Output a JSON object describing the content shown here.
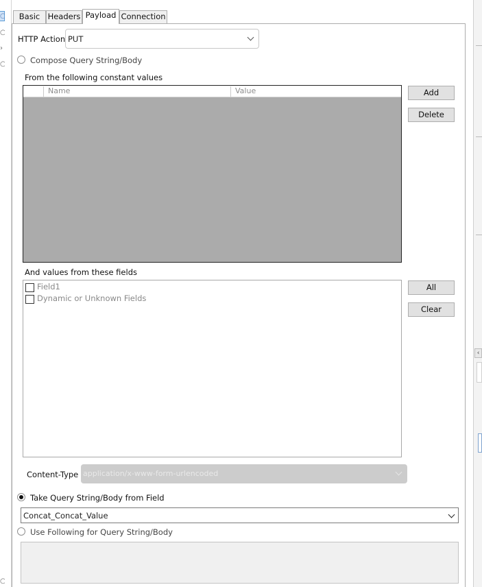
{
  "tabs": [
    "Basic",
    "Headers",
    "Payload",
    "Connection"
  ],
  "active_tab": "Payload",
  "http_action": {
    "label": "HTTP Action",
    "value": "PUT"
  },
  "compose_option": {
    "label": "Compose Query String/Body",
    "selected": false
  },
  "constants_section": {
    "title": "From the following constant values",
    "columns": [
      "Name",
      "Value"
    ],
    "rows": [],
    "buttons": {
      "add": "Add",
      "delete": "Delete"
    }
  },
  "fields_section": {
    "title": "And values from these fields",
    "fields": [
      {
        "label": "Field1",
        "checked": false
      },
      {
        "label": "Dynamic or Unknown Fields",
        "checked": false
      }
    ],
    "buttons": {
      "all": "All",
      "clear": "Clear"
    }
  },
  "content_type": {
    "label": "Content-Type",
    "value": "application/x-www-form-urlencoded",
    "disabled": true
  },
  "take_from_field_option": {
    "label": "Take Query String/Body from Field",
    "selected": true
  },
  "field_selector": {
    "value": "Concat_Concat_Value"
  },
  "use_following_option": {
    "label": "Use Following for Query String/Body",
    "selected": false
  },
  "body_text": {
    "value": ""
  },
  "colors": {
    "grid_background": "#ababab",
    "disabled_combo": "#cccccc",
    "panel_border": "#acacac"
  }
}
